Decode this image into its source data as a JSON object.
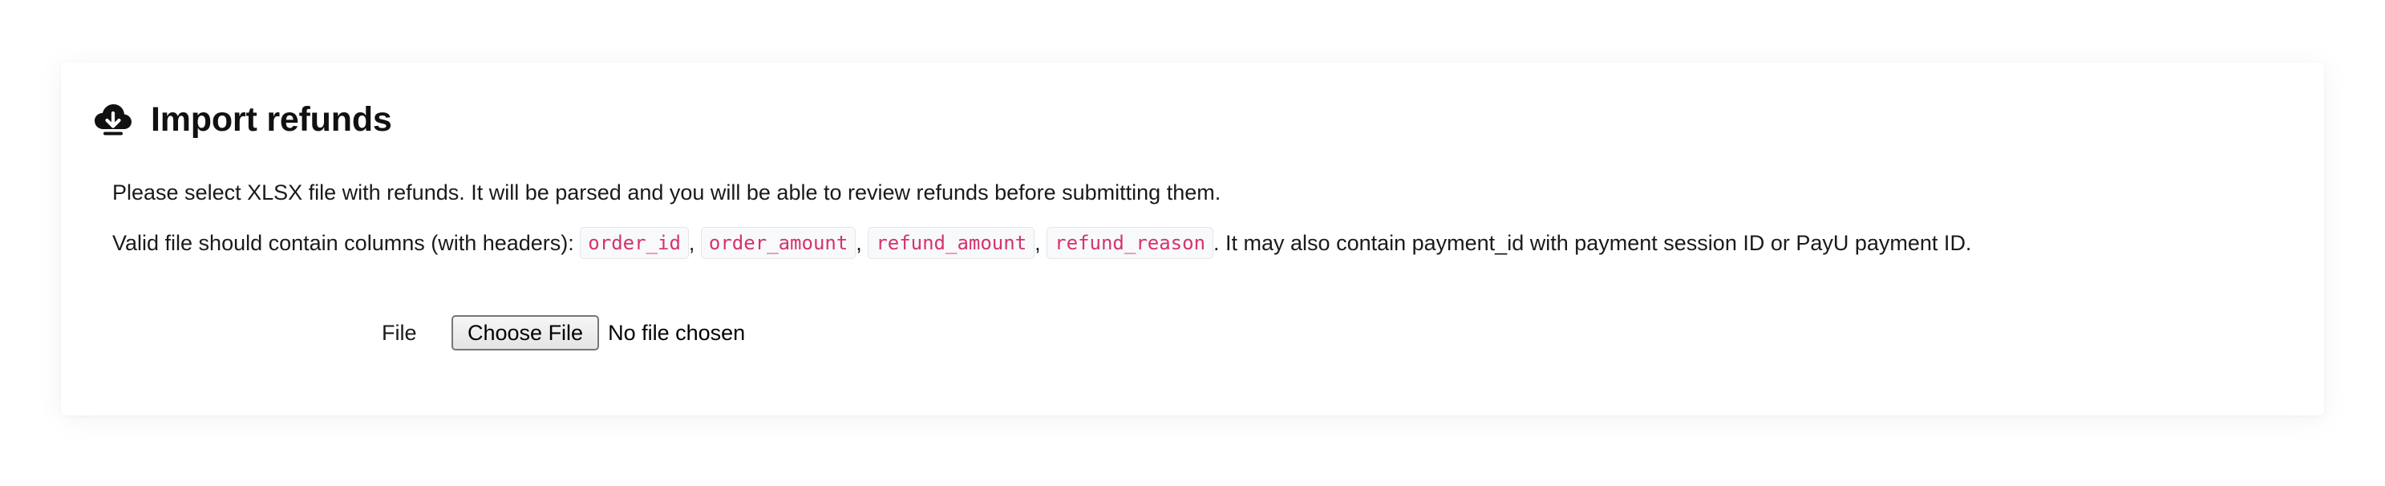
{
  "panel": {
    "icon": "cloud-download-icon",
    "title": "Import refunds"
  },
  "instructions": {
    "line1": "Please select XLSX file with refunds. It will be parsed and you will be able to review refunds before submitting them.",
    "line2_prefix": "Valid file should contain columns (with headers): ",
    "columns": [
      "order_id",
      "order_amount",
      "refund_amount",
      "refund_reason"
    ],
    "separator": ", ",
    "line2_suffix": ". It may also contain payment_id with payment session ID or PayU payment ID."
  },
  "form": {
    "file_label": "File",
    "choose_button_label": "Choose File",
    "file_status": "No file chosen"
  },
  "colors": {
    "code_text": "#d6336c",
    "code_background": "#f8f9fa"
  }
}
